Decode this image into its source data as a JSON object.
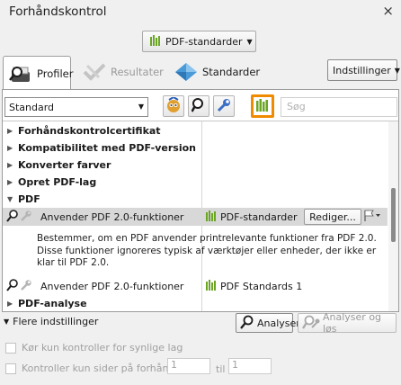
{
  "window": {
    "title": "Forhåndskontrol",
    "close_glyph": "×"
  },
  "top_dropdown": {
    "label": "PDF-standarder",
    "icon": "standards-bars-icon"
  },
  "tabs": [
    {
      "label": "Profiler",
      "icon": "profile-magnifier-icon",
      "active": true
    },
    {
      "label": "Resultater",
      "icon": "results-checkmark-icon",
      "active": false,
      "disabled": true
    },
    {
      "label": "Standarder",
      "icon": "standards-diamond-icon",
      "active": false
    }
  ],
  "settings_menu": {
    "label": "Indstillinger"
  },
  "profile_bar": {
    "profile_select_value": "Standard",
    "search_placeholder": "Søg"
  },
  "tree": {
    "groups_top": [
      {
        "label": "Forhåndskontrolcertifikat",
        "expanded": false
      },
      {
        "label": "Kompatibilitet med PDF-version",
        "expanded": false
      },
      {
        "label": "Konverter farver",
        "expanded": false
      },
      {
        "label": "Opret PDF-lag",
        "expanded": false
      },
      {
        "label": "PDF",
        "expanded": true
      }
    ],
    "selected_rule": {
      "name": "Anvender PDF 2.0-funktioner",
      "standard": "PDF-standarder",
      "edit_label": "Rediger...",
      "description": "Bestemmer, om en PDF anvender printrelevante funktioner fra PDF 2.0. Disse funktioner ignoreres typisk af værktøjer eller enheder, der ikke er klar til PDF 2.0."
    },
    "second_rule": {
      "name": "Anvender PDF 2.0-funktioner",
      "standard": "PDF Standards 1"
    },
    "group_bottom": {
      "label": "PDF-analyse",
      "expanded": false
    }
  },
  "bottom": {
    "more_settings": "Flere indstillinger",
    "analyze_button": "Analyser",
    "analyze_fix_button": "Analyser og løs",
    "check_visible_layers": "Kør kun kontroller for synlige lag",
    "check_pages_only": "Kontroller kun sider på forhånd",
    "page_from": "1",
    "page_to_label": "til",
    "page_to": "1"
  },
  "colors": {
    "accent_orange": "#f08a00",
    "standards_green": "#6aa524",
    "selection_gray": "#d8d8d8"
  }
}
